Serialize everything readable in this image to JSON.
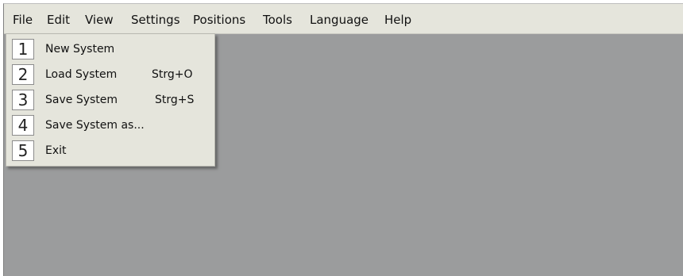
{
  "menubar": {
    "items": [
      {
        "label": "File"
      },
      {
        "label": "Edit"
      },
      {
        "label": "View"
      },
      {
        "label": "Settings"
      },
      {
        "label": "Positions"
      },
      {
        "label": "Tools"
      },
      {
        "label": "Language"
      },
      {
        "label": "Help"
      }
    ]
  },
  "file_menu": {
    "items": [
      {
        "number": "1",
        "label": "New System",
        "shortcut": ""
      },
      {
        "number": "2",
        "label": "Load System",
        "shortcut": "Strg+O"
      },
      {
        "number": "3",
        "label": "Save System",
        "shortcut": "Strg+S"
      },
      {
        "number": "4",
        "label": "Save System as...",
        "shortcut": ""
      },
      {
        "number": "5",
        "label": "Exit",
        "shortcut": ""
      }
    ]
  },
  "colors": {
    "menubar_background": "#e5e5dc",
    "workspace_background": "#9b9c9d",
    "badge_background": "#ffffff"
  }
}
